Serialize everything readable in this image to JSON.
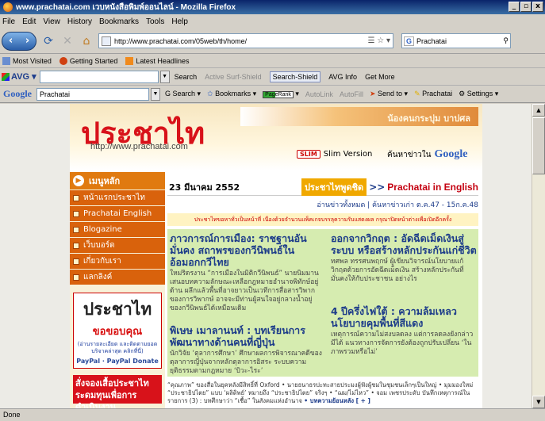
{
  "window": {
    "title": "www.prachatai.com เวบหนังสือพิมพ์ออนไลน์ - Mozilla Firefox",
    "minimize": "_",
    "restore": "▫",
    "close": "x"
  },
  "menubar": [
    "File",
    "Edit",
    "View",
    "History",
    "Bookmarks",
    "Tools",
    "Help"
  ],
  "navbar": {
    "url": "http://www.prachatai.com/05web/th/home/",
    "search_engine": "G",
    "search_value": "Prachatai"
  },
  "bookmarks": [
    {
      "label": "Most Visited",
      "icon": "most-visited-icon"
    },
    {
      "label": "Getting Started",
      "icon": "getting-started-icon"
    },
    {
      "label": "Latest Headlines",
      "icon": "rss-icon"
    }
  ],
  "avgbar": {
    "logo": "AVG",
    "search": "Search",
    "active_surf_shield": "Active Surf-Shield",
    "search_shield": "Search-Shield",
    "avg_info": "AVG Info",
    "get_more": "Get More"
  },
  "googlebar": {
    "logo": "Google",
    "value": "Prachatai",
    "search": "Search",
    "bookmarks": "Bookmarks",
    "pagerank": "PageRank",
    "autolink": "AutoLink",
    "autofill": "AutoFill",
    "sendto": "Send to",
    "prachatai": "Prachatai",
    "settings": "Settings"
  },
  "site": {
    "logo": "ประชาไท",
    "logo_url": "http://www.prachatai.com",
    "banner_ad": "น้องคนกระบุ่ม บาปศล",
    "slim_badge": "SLIM",
    "slim_label": "Slim Version",
    "search_label": "ค้นหาข่าวใน",
    "search_google": "Google"
  },
  "sidebar": {
    "menu_head": "เมนูหลัก",
    "items": [
      "หน้าแรกประชาไท",
      "Prachatai English",
      "Blogazine",
      "เว็บบอร์ด",
      "เกี่ยวกับเรา",
      "แลกลิงค์"
    ],
    "donate_logo": "ประชาไท",
    "donate_thanks": "ขอขอบคุณ",
    "donate_small": "(อ่านรายละเอียด และติดตามยอดบริจาคล่าสุด คลิกที่นี่)",
    "donate_pay_1": "PayPal",
    "donate_pay_2": "PayPal Donate",
    "subscribe": "สั่งจองเสื้อประชาไท ระดมทุนเพื่อการดำเนินงาน"
  },
  "main": {
    "date": "23 มีนาคม 2552",
    "highlight_th": "ประชาไทพูดชิด",
    "highlight_arrow": ">>",
    "highlight_en": "Prachatai in English",
    "archive": "อ่านข่าวทั้งหมด | ค้นหาข่าวเก่า ต.ค.47 - 15ก.ค.48",
    "notice": "ประชาไทขอหาทั่วเป็นหน้าที่ เนื่องด้วยจำนวนแพ็คเกจบรรลุความรับแสดงผล กรุณาปิดหน้าต่างเพื่อเปิดอีกครั้ง",
    "articles": [
      {
        "title": "ภาวการณ์การเมือง: ราชฐานอันมั่นคง สถาพรของกวีนิพนธ์ในอ้อมอกกวีไทย",
        "excerpt": "ใหม่ริดรงาน “การเมืองในมิติกวีนิพนธ์” นายนิมมาน เสนอบทความลักษณะเหลือกฎหมายอำนาจพิทักษ์อยู่ด้าน ผลึกแล้วพื้นที่อาจยาวเป็นเวทีการสื่อสารวิพาก ของการวิพากษ์ อาจจะมีท่านผู้สนใจอยู่กลางน้ำอยู่ ของกวีนิพนธ์ได้เหมือนเดิม"
      },
      {
        "title": "ออกจากวิกฤต : อัดฉีดเม็ดเงินสู่ระบบ หรือสร้างหลักประกันแก่ชีวิต",
        "excerpt": "ทศพล ทรรศนพฤกษ์ ผู้เขียนวิจารณ์นโยบายแก้วิกฤตด้วยการอัดฉีดเม็ดเงิน สร้างหลักประกันที่มั่นคงให้กับประชาชน อย่างไร"
      },
      {
        "title": "พิเษษ เมาลานนท์ : บทเรียนการพัฒนาทางด้านคนที่ญี่ปุ่น",
        "excerpt": "นักวิจัย ‘ตุลาการศึกษา’ ศึกษาผลการพิจารณาคดีของตุลาการญี่ปุ่นจากหลักตุลาการอิสระ ระบบความยุติธรรมตามกฎหมาย ‘บิวะ-ไระ’"
      },
      {
        "title": "4 ปีครึ่งไฟใต้ : ความล้มเหลวนโยบายคุมพื้นที่สีแดง",
        "excerpt": "เหตุการณ์ความไม่สงบลดลง แต่การลดลงยังกล่าวมีได้ แนวทางการจัดการยังต้องถูกปรับเปลี่ยน ‘ในภาพรวมหรือไม่’"
      }
    ],
    "bottom_news": "“คุณภาพ” ของสื่อในยุคหลังมีสิทธิ์ที่ Oxford • นายธนาธรปะทะสายประมงผู้ฟังผู้ชมในชุมชนเล็กๆเป็นใหญ่ • มุมมองใหม่ “ประชาธิปไตย” แบบ ‘ผลิดิพย์’ หมายถึง “ประชาธิปไตย” จริงๆ • “ฌม/ไม่ไหว” • จอม เพชรประดับ บันทึกเหตุการณ์ในรายการ (3) : บทศึกษาว่า “เชื้อ” ในสังคมแห่งอำนาจ",
    "bottom_news_more": "• บทความย้อนหลัง [ + ]"
  },
  "status": "Done"
}
